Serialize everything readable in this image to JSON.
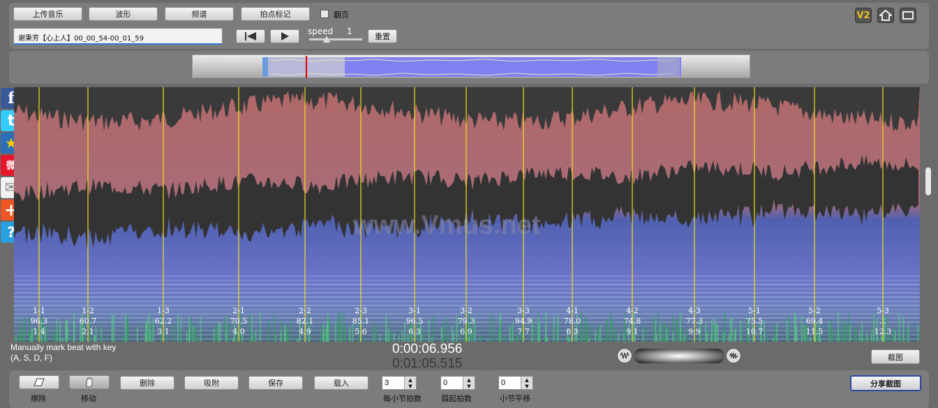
{
  "toolbar": {
    "upload_label": "上传音乐",
    "waveform_label": "波形",
    "spectrum_label": "频谱",
    "beat_mark_label": "拍点标记",
    "page_flip_label": "翻页",
    "track_title": "谢秉芳【心上人】00_00_54-00_01_59",
    "speed_label": "speed",
    "speed_value": "1",
    "replay_label": "重置",
    "v2_label": "V2"
  },
  "watermark": "www.Vmus.net",
  "beats": [
    {
      "id": "1-1",
      "bpm": "96.3",
      "time": "1.4"
    },
    {
      "id": "1-2",
      "bpm": "60.7",
      "time": "2.1"
    },
    {
      "id": "1-3",
      "bpm": "62.2",
      "time": "3.1"
    },
    {
      "id": "2-1",
      "bpm": "70.5",
      "time": "4.0"
    },
    {
      "id": "2-2",
      "bpm": "82.1",
      "time": "4.9"
    },
    {
      "id": "2-3",
      "bpm": "85.1",
      "time": "5.6"
    },
    {
      "id": "3-1",
      "bpm": "96.5",
      "time": "6.3"
    },
    {
      "id": "3-2",
      "bpm": "79.3",
      "time": "6.9"
    },
    {
      "id": "3-3",
      "bpm": "94.9",
      "time": "7.7"
    },
    {
      "id": "4-1",
      "bpm": "78.0",
      "time": "8.3"
    },
    {
      "id": "4-2",
      "bpm": "74.8",
      "time": "9.1"
    },
    {
      "id": "4-3",
      "bpm": "77.3",
      "time": "9.9"
    },
    {
      "id": "5-1",
      "bpm": "75.5",
      "time": "10.7"
    },
    {
      "id": "5-2",
      "bpm": "69.4",
      "time": "11.5"
    },
    {
      "id": "5-3",
      "bpm": "...",
      "time": "12.3"
    }
  ],
  "status": {
    "hint_line1": "Manually mark beat with key",
    "hint_line2": "(A, S, D, F)",
    "current_time": "0:00:06.956",
    "total_time": "0:01:05.515",
    "screenshot_label": "截图"
  },
  "bottom": {
    "erase_label": "擦除",
    "move_label": "移动",
    "delete_label": "删除",
    "snap_label": "吸附",
    "save_label": "保存",
    "load_label": "载入",
    "beats_per_bar_value": "3",
    "beats_per_bar_label": "每小节拍数",
    "pickup_value": "0",
    "pickup_label": "弱起拍数",
    "bar_shift_value": "0",
    "bar_shift_label": "小节平移",
    "share_label": "分享截图"
  },
  "social": [
    {
      "name": "facebook",
      "color": "#3b5998",
      "glyph": "f"
    },
    {
      "name": "twitter",
      "color": "#33ccff",
      "glyph": "t"
    },
    {
      "name": "favorite",
      "color": "#2a6fb8",
      "glyph": "★"
    },
    {
      "name": "weibo",
      "color": "#e6162d",
      "glyph": "微"
    },
    {
      "name": "mail",
      "color": "#f2f2f2",
      "glyph": "✉"
    },
    {
      "name": "add",
      "color": "#ee5522",
      "glyph": "+"
    },
    {
      "name": "help",
      "color": "#2aa0e0",
      "glyph": "?"
    }
  ]
}
